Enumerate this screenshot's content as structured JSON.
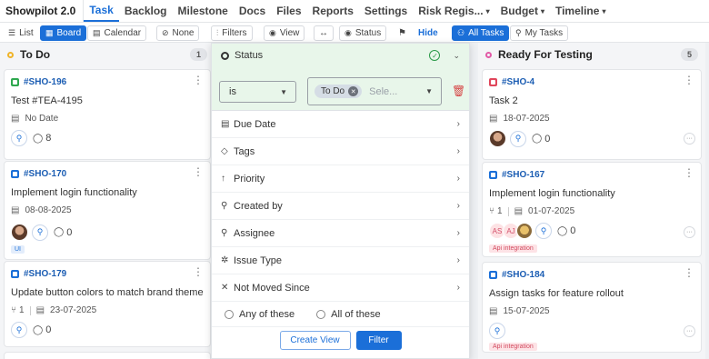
{
  "nav": {
    "brand": "Showpilot 2.0",
    "tabs": [
      {
        "label": "Task",
        "active": true
      },
      {
        "label": "Backlog"
      },
      {
        "label": "Milestone"
      },
      {
        "label": "Docs"
      },
      {
        "label": "Files"
      },
      {
        "label": "Reports"
      },
      {
        "label": "Settings"
      },
      {
        "label": "Risk Regis..."
      },
      {
        "label": "Budget"
      },
      {
        "label": "Timeline"
      }
    ]
  },
  "toolbar": {
    "list": "List",
    "board": "Board",
    "calendar": "Calendar",
    "none": "None",
    "filters": "Filters",
    "view": "View",
    "status": "Status",
    "hide": "Hide",
    "all_tasks": "All Tasks",
    "my_tasks": "My Tasks"
  },
  "columns": {
    "todo": {
      "name": "To Do",
      "count": "1",
      "cards": [
        {
          "key": "#SHO-196",
          "title": "Test #TEA-4195",
          "date": "No Date",
          "comments": "8"
        },
        {
          "key": "#SHO-170",
          "title": "Implement login functionality",
          "date": "08-08-2025",
          "comments": "0",
          "label": "UI"
        },
        {
          "key": "#SHO-179",
          "title": "Update button colors to match brand theme",
          "subtasks": "1",
          "date": "23-07-2025",
          "comments": "0"
        }
      ]
    },
    "ready": {
      "name": "Ready For Testing",
      "count": "5",
      "cards": [
        {
          "key": "#SHO-4",
          "title": "Task 2",
          "date": "18-07-2025",
          "comments": "0"
        },
        {
          "key": "#SHO-167",
          "title": "Implement login functionality",
          "subtasks": "1",
          "date": "01-07-2025",
          "comments": "0",
          "initials": [
            "AS",
            "AJ"
          ],
          "label": "Api integration"
        },
        {
          "key": "#SHO-184",
          "title": "Assign tasks for feature rollout",
          "date": "15-07-2025",
          "label": "Api integration"
        }
      ]
    }
  },
  "filter": {
    "field": "Status",
    "operator": "is",
    "value_chip": "To Do",
    "value_placeholder": "Sele...",
    "rows": [
      "Due Date",
      "Tags",
      "Priority",
      "Created by",
      "Assignee",
      "Issue Type",
      "Not Moved Since"
    ],
    "match_any": "Any of these",
    "match_all": "All of these",
    "create_view": "Create View",
    "apply": "Filter"
  },
  "colors": {
    "accent": "#1b6fd8",
    "filter_active_bg": "#e8f6ea",
    "todo_dot": "#f0b429",
    "ready_dot": "#e25aa7"
  }
}
